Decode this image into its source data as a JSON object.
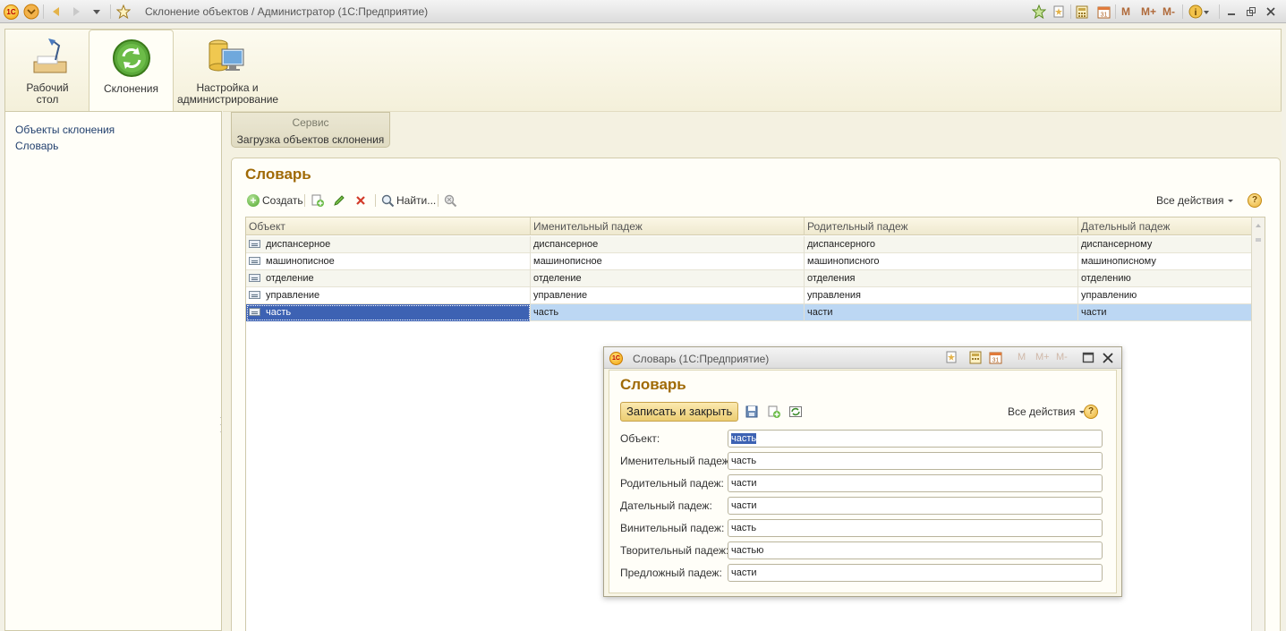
{
  "window": {
    "title": "Склонение объектов / Администратор  (1С:Предприятие)",
    "right_toolbar": [
      "M",
      "M+",
      "M-"
    ]
  },
  "sections": [
    {
      "label_line1": "Рабочий",
      "label_line2": "стол",
      "icon": "desk-lamp-icon"
    },
    {
      "label_line1": "Склонения",
      "label_line2": "",
      "icon": "refresh-circle-icon"
    },
    {
      "label_line1": "Настройка и",
      "label_line2": "администрирование",
      "icon": "database-computer-icon"
    }
  ],
  "leftnav": {
    "items": [
      "Объекты склонения",
      "Словарь"
    ]
  },
  "service": {
    "header": "Сервис",
    "item": "Загрузка объектов склонения"
  },
  "list": {
    "title": "Словарь",
    "toolbar": {
      "create": "Создать",
      "find": "Найти...",
      "all_actions": "Все действия"
    },
    "columns": [
      "Объект",
      "Именительный падеж",
      "Родительный падеж",
      "Дательный падеж"
    ],
    "rows": [
      [
        "диспансерное",
        "диспансерное",
        "диспансерного",
        "диспансерному"
      ],
      [
        "машинописное",
        "машинописное",
        "машинописного",
        "машинописному"
      ],
      [
        "отделение",
        "отделение",
        "отделения",
        "отделению"
      ],
      [
        "управление",
        "управление",
        "управления",
        "управлению"
      ],
      [
        "часть",
        "часть",
        "части",
        "части"
      ]
    ],
    "selected_row": 4
  },
  "dialog": {
    "title": "Словарь  (1С:Предприятие)",
    "heading": "Словарь",
    "save_close": "Записать и закрыть",
    "all_actions": "Все действия",
    "toolbar_right": [
      "M",
      "M+",
      "M-"
    ],
    "fields": [
      {
        "label": "Объект:",
        "value": "часть"
      },
      {
        "label": "Именительный падеж:",
        "value": "часть"
      },
      {
        "label": "Родительный падеж:",
        "value": "части"
      },
      {
        "label": "Дательный падеж:",
        "value": "части"
      },
      {
        "label": "Винительный падеж:",
        "value": "часть"
      },
      {
        "label": "Творительный падеж:",
        "value": "частью"
      },
      {
        "label": "Предложный падеж:",
        "value": "части"
      }
    ]
  },
  "colors": {
    "accent_title": "#a06a06",
    "selection": "#bcd7f3",
    "selection_cell": "#3d62b3",
    "link": "#22406e"
  }
}
